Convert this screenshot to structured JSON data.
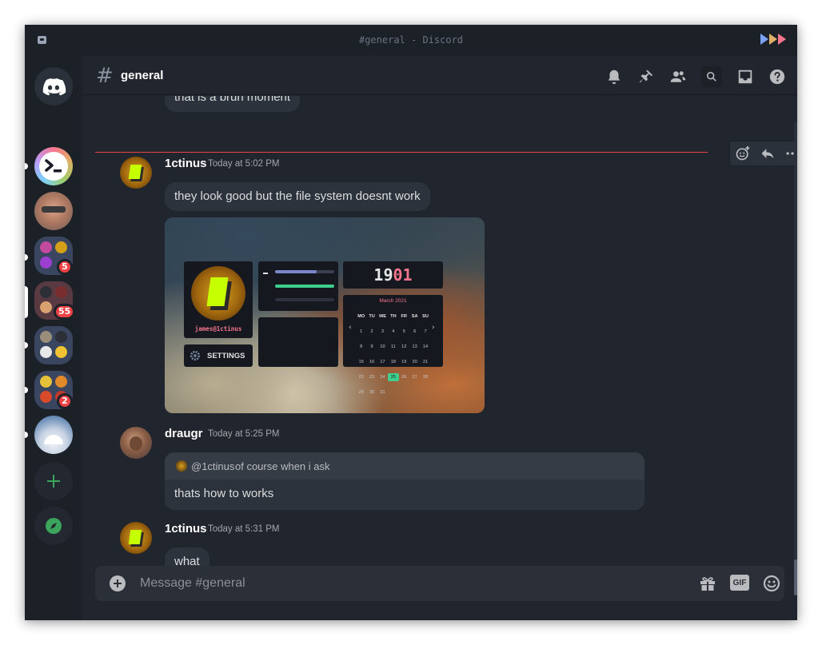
{
  "window": {
    "title": "#general - Discord",
    "control_colors": [
      "#7aa2f7",
      "#e0af68",
      "#f7768e"
    ]
  },
  "sidebar": {
    "badges": {
      "server3": "5",
      "server4": "55",
      "server6": "2"
    }
  },
  "header": {
    "channel": "general"
  },
  "messages": {
    "prev_text": "that is a bruh moment",
    "m1": {
      "user": "1ctinus",
      "time": "Today at 5:02 PM",
      "text": "they look good but the file system doesnt work"
    },
    "m2": {
      "user": "draugr",
      "time": "Today at 5:25 PM",
      "reply_mention": "@1ctinus",
      "reply_text": "of course when i ask",
      "text": "thats how to works"
    },
    "m3": {
      "user": "1ctinus",
      "time": "Today at 5:31 PM",
      "text": "what"
    }
  },
  "embed": {
    "profile_name": "james@1ctinus",
    "settings_label": "SETTINGS",
    "clock_hours": "19",
    "clock_minutes": "01",
    "calendar": {
      "month": "March 2021",
      "weekdays": [
        "MO",
        "TU",
        "WE",
        "TH",
        "FR",
        "SA",
        "SU"
      ],
      "rows": [
        [
          "",
          "",
          "",
          "",
          "",
          "",
          ""
        ],
        [
          "1",
          "2",
          "3",
          "4",
          "5",
          "6",
          "7"
        ],
        [
          "8",
          "9",
          "10",
          "11",
          "12",
          "13",
          "14"
        ],
        [
          "15",
          "16",
          "17",
          "18",
          "19",
          "20",
          "21"
        ],
        [
          "22",
          "23",
          "24",
          "25",
          "26",
          "27",
          "28"
        ],
        [
          "29",
          "30",
          "31",
          "",
          "",
          "",
          ""
        ]
      ],
      "today": "25"
    }
  },
  "composer": {
    "placeholder": "Message #general",
    "gif_label": "GIF"
  },
  "colors": {
    "accent": "#ed4245",
    "online": "#3ba55d",
    "bubble": "#2d333c"
  }
}
